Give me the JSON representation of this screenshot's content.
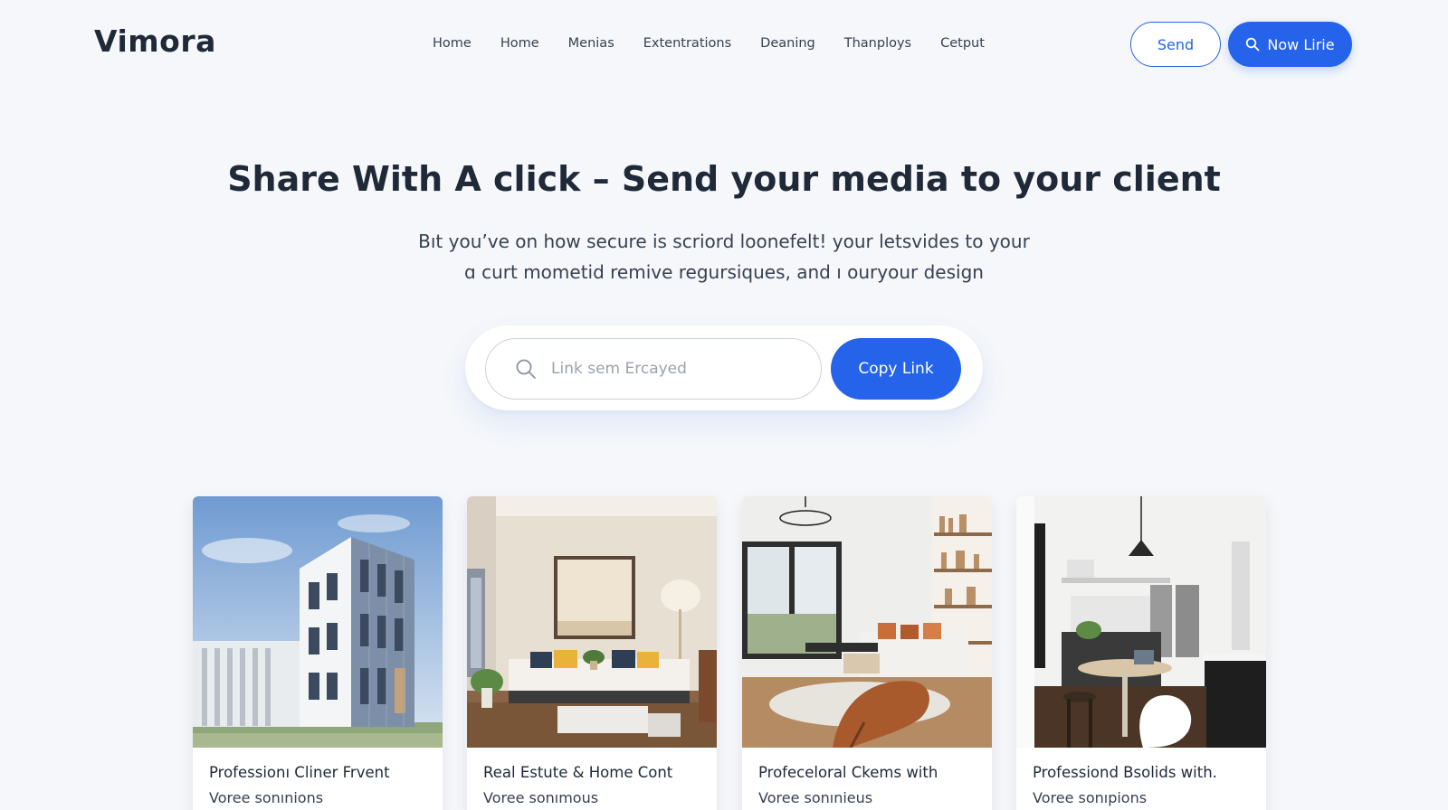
{
  "header": {
    "brand": "Vimora",
    "nav": [
      "Home",
      "Home",
      "Menias",
      "Extentrations",
      "Deaning",
      "Thanploys",
      "Cetput"
    ],
    "send_label": "Send",
    "primary_label": "Now Lirie"
  },
  "hero": {
    "title": "Share With A click – Send your media to your client",
    "subtitle_line1": "Bıt you’ve on how secure is scriord loonefelt! your letsvides to your",
    "subtitle_line2": "ɑ curt mometid remive regursiques, and ı ouryour design"
  },
  "share": {
    "placeholder": "Link sem Ercayed",
    "copy_label": "Copy Link"
  },
  "cards": [
    {
      "title": "Professionı Cliner Frvent",
      "subtitle": "Voree sonınions"
    },
    {
      "title": "Real Estute & Home Cont",
      "subtitle": "Voree sonımous"
    },
    {
      "title": "Profeceloral Ckems with",
      "subtitle": "Voree sonınieus"
    },
    {
      "title": "Professiond Bsolids with.",
      "subtitle": "Voree sonıpions"
    }
  ],
  "colors": {
    "accent": "#2563eb",
    "background": "#f5f7fa",
    "text": "#1f2937"
  }
}
